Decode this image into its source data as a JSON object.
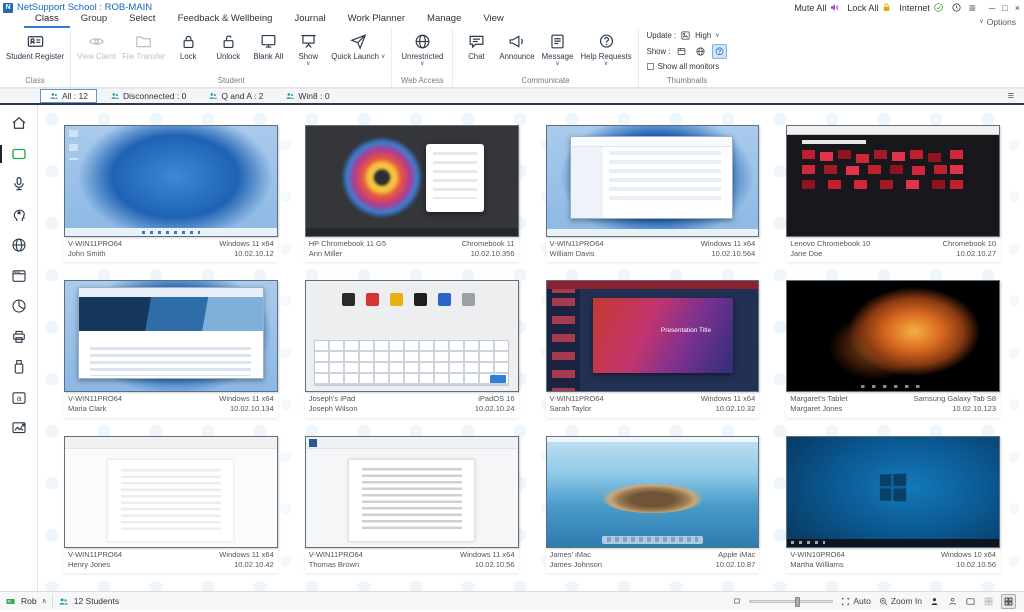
{
  "titlebar": {
    "app_title": "NetSupport School : ROB-MAIN",
    "mute_all": "Mute All",
    "lock_all": "Lock All",
    "internet": "Internet"
  },
  "menu": {
    "options_label": "Options",
    "tabs": [
      {
        "label": "Class",
        "active": true
      },
      {
        "label": "Group",
        "active": false
      },
      {
        "label": "Select",
        "active": false
      },
      {
        "label": "Feedback & Wellbeing",
        "active": false
      },
      {
        "label": "Journal",
        "active": false
      },
      {
        "label": "Work Planner",
        "active": false
      },
      {
        "label": "Manage",
        "active": false
      },
      {
        "label": "View",
        "active": false
      }
    ]
  },
  "ribbon": {
    "groups": [
      {
        "name": "Class",
        "buttons": [
          {
            "label": "Student Register",
            "icon": "id-card"
          }
        ]
      },
      {
        "name": "Student",
        "buttons": [
          {
            "label": "View Client",
            "icon": "eye",
            "disabled": true
          },
          {
            "label": "File Transfer",
            "icon": "folder",
            "disabled": true
          },
          {
            "label": "Lock",
            "icon": "lock"
          },
          {
            "label": "Unlock",
            "icon": "unlock"
          },
          {
            "label": "Blank All",
            "icon": "monitor"
          },
          {
            "label": "Show",
            "icon": "presentation",
            "chevron": true
          },
          {
            "label": "Quick Launch",
            "icon": "paper-plane",
            "chevron": true
          }
        ]
      },
      {
        "name": "Web Access",
        "buttons": [
          {
            "label": "Unrestricted",
            "icon": "globe",
            "chevron": true
          }
        ]
      },
      {
        "name": "Communicate",
        "buttons": [
          {
            "label": "Chat",
            "icon": "chat-bubble"
          },
          {
            "label": "Announce",
            "icon": "megaphone"
          },
          {
            "label": "Message",
            "icon": "note",
            "chevron": true
          },
          {
            "label": "Help Requests",
            "icon": "help-bubble",
            "chevron": true
          }
        ]
      },
      {
        "name": "Thumbnails",
        "update_label": "Update :",
        "update_value": "High",
        "show_label": "Show :",
        "show_all_monitors_label": "Show all monitors",
        "show_all_monitors_checked": false
      }
    ]
  },
  "filter_tabs": [
    {
      "label": "All : 12",
      "active": true
    },
    {
      "label": "Disconnected : 0",
      "active": false
    },
    {
      "label": "Q and A : 2",
      "active": false
    },
    {
      "label": "Win8 : 0",
      "active": false
    }
  ],
  "sidebar": {
    "items": [
      {
        "name": "home",
        "active": false
      },
      {
        "name": "monitor",
        "active": true
      },
      {
        "name": "audio",
        "active": false
      },
      {
        "name": "wellbeing",
        "active": false
      },
      {
        "name": "web",
        "active": false
      },
      {
        "name": "applications",
        "active": false
      },
      {
        "name": "surveys",
        "active": false
      },
      {
        "name": "print",
        "active": false
      },
      {
        "name": "devices",
        "active": false
      },
      {
        "name": "typing",
        "active": false
      },
      {
        "name": "screen-capture",
        "active": false
      }
    ]
  },
  "students": [
    {
      "machine": "V-WIN11PRO64",
      "name": "John Smith",
      "os": "Windows 11 x64",
      "ip": "10.02.10.12",
      "screen": "win11"
    },
    {
      "machine": "HP Chromebook 11 G5",
      "name": "Ann Miller",
      "os": "Chromebook 11",
      "ip": "10.02.10.356",
      "screen": "chromeos"
    },
    {
      "machine": "V-WIN11PRO64",
      "name": "William Davis",
      "os": "Windows 11 x64",
      "ip": "10.02.10.564",
      "screen": "explorer"
    },
    {
      "machine": "Lenovo Chromebook 10",
      "name": "Jane Doe",
      "os": "Chromebook 10",
      "ip": "10.02.10.27",
      "screen": "webdark"
    },
    {
      "machine": "V-WIN11PRO64",
      "name": "Maria Clark",
      "os": "Windows 11 x64",
      "ip": "10.02.10.134",
      "screen": "browser"
    },
    {
      "machine": "Joseph's iPad",
      "name": "Joseph Wilson",
      "os": "iPadOS 16",
      "ip": "10.02.10.24",
      "screen": "ipad"
    },
    {
      "machine": "V-WIN11PRO64",
      "name": "Sarah Taylor",
      "os": "Windows 11 x64",
      "ip": "10.02.10.32",
      "screen": "ppt",
      "screen_text": "Presentation Title"
    },
    {
      "machine": "Margaret's Tablet",
      "name": "Margaret Jones",
      "os": "Samsung Galaxy Tab S8",
      "ip": "10.02.10.123",
      "screen": "tablet"
    },
    {
      "machine": "V-WIN11PRO64",
      "name": "Henry Jones",
      "os": "Windows 11 x64",
      "ip": "10.02.10.42",
      "screen": "docfaded"
    },
    {
      "machine": "V-WIN11PRO64",
      "name": "Thomas Brown",
      "os": "Windows 11 x64",
      "ip": "10.02.10.56",
      "screen": "doc"
    },
    {
      "machine": "James' iMac",
      "name": "James Johnson",
      "os": "Apple iMac",
      "ip": "10.02.10.87",
      "screen": "macos"
    },
    {
      "machine": "V-WIN10PRO64",
      "name": "Martha Williams",
      "os": "Windows 10 x64",
      "ip": "10.02.10.56",
      "screen": "win10"
    }
  ],
  "statusbar": {
    "user": "Rob",
    "students": "12 Students",
    "auto_label": "Auto",
    "zoom_label": "Zoom In"
  },
  "icons": {
    "chevron_down": "∨",
    "chevron_up": "∧",
    "hamburger": "≡",
    "minimize": "─",
    "maximize": "□",
    "close": "×"
  },
  "colors": {
    "accent": "#1f6cb5",
    "green": "#3aa655",
    "teal": "#17939f",
    "mute_purple": "#9a4fd1",
    "lock_gold": "#dfa800"
  }
}
